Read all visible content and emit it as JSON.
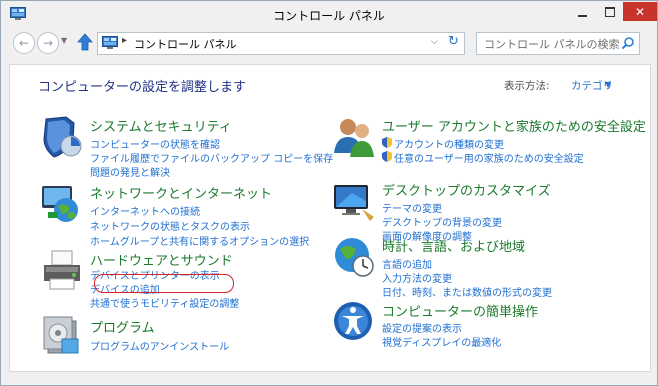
{
  "window": {
    "title": "コントロール パネル",
    "close_glyph": "✕"
  },
  "nav": {
    "address_separator": "▸",
    "address_path": "コントロール パネル",
    "search_placeholder": "コントロール パネルの検索"
  },
  "main": {
    "heading": "コンピューターの設定を調整します",
    "view_by_label": "表示方法:",
    "view_by_value": "カテゴリ",
    "categories": [
      {
        "title": "システムとセキュリティ",
        "icon": "shield-icon",
        "links": [
          "コンピューターの状態を確認",
          "ファイル履歴でファイルのバックアップ コピーを保存",
          "問題の発見と解決"
        ]
      },
      {
        "title": "ネットワークとインターネット",
        "icon": "network-globe-icon",
        "links": [
          "インターネットへの接続",
          "ネットワークの状態とタスクの表示",
          "ホームグループと共有に関するオプションの選択"
        ]
      },
      {
        "title": "ハードウェアとサウンド",
        "icon": "printer-icon",
        "links": [
          "デバイスとプリンターの表示",
          "デバイスの追加",
          "共通で使うモビリティ設定の調整"
        ]
      },
      {
        "title": "プログラム",
        "icon": "programs-icon",
        "links": [
          "プログラムのアンインストール"
        ]
      },
      {
        "title": "ユーザー アカウントと家族のための安全設定",
        "icon": "users-icon",
        "links": [
          "アカウントの種類の変更",
          "任意のユーザー用の家族のための安全設定"
        ]
      },
      {
        "title": "デスクトップのカスタマイズ",
        "icon": "monitor-icon",
        "links": [
          "テーマの変更",
          "デスクトップの背景の変更",
          "画面の解像度の調整"
        ]
      },
      {
        "title": "時計、言語、および地域",
        "icon": "clock-globe-icon",
        "links": [
          "言語の追加",
          "入力方法の変更",
          "日付、時刻、または数値の形式の変更"
        ]
      },
      {
        "title": "コンピューターの簡単操作",
        "icon": "ease-of-access-icon",
        "links": [
          "設定の提案の表示",
          "視覚ディスプレイの最適化"
        ]
      }
    ]
  }
}
